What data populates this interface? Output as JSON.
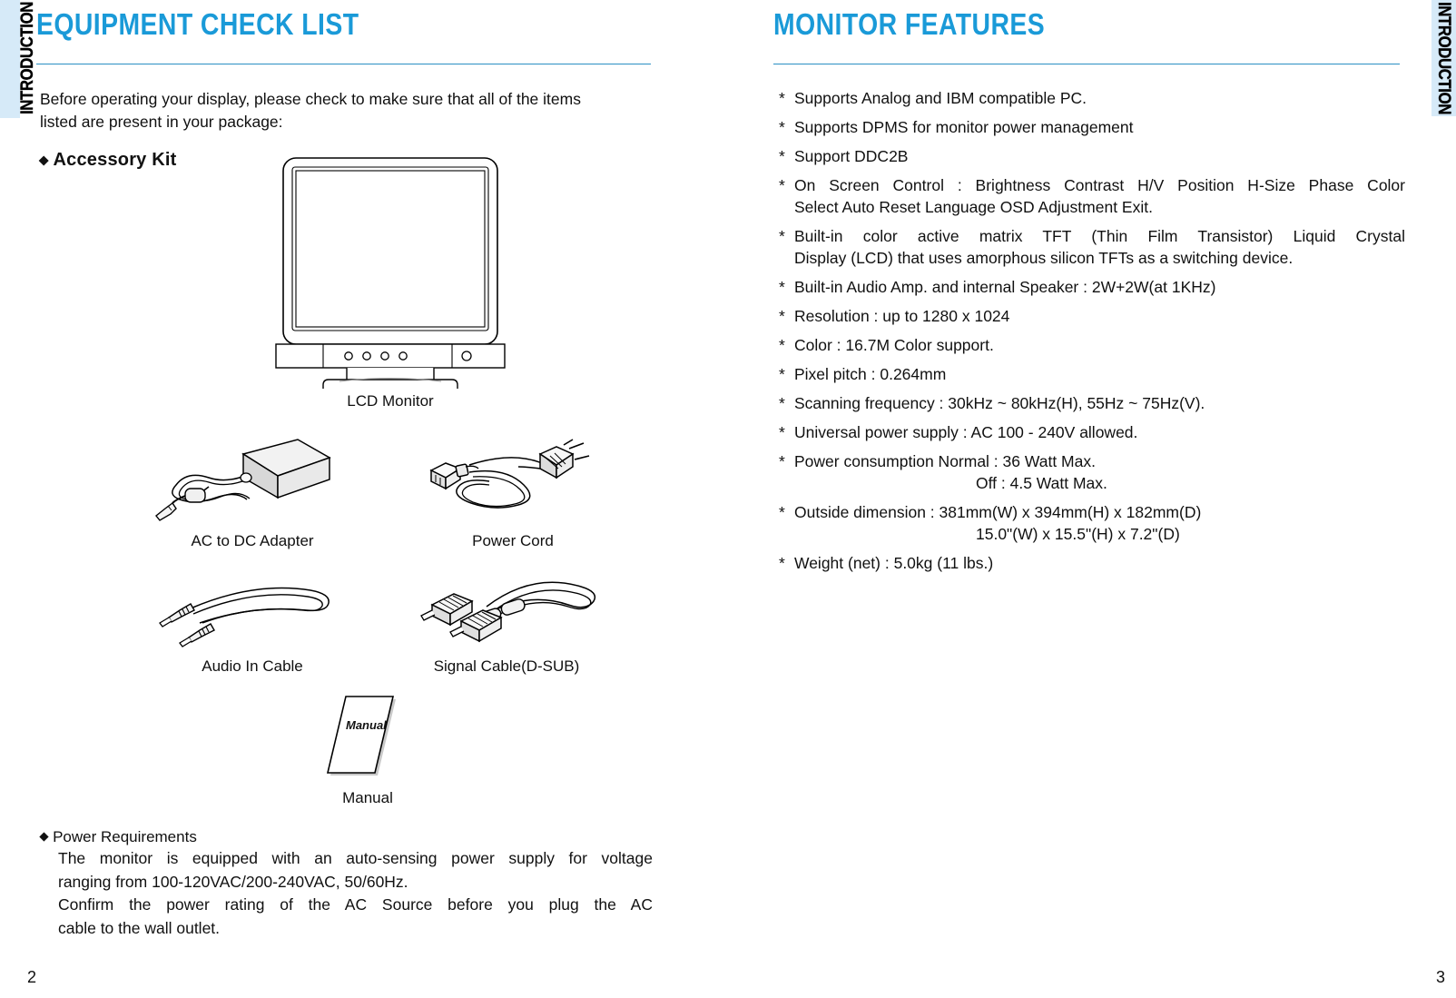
{
  "tabs": {
    "left_label": "INTRODUCTION",
    "right_label": "INTRODUCTION",
    "tab_color": "#d6eaf8"
  },
  "theme": {
    "heading_blue": "#1a9ad8",
    "rule_blue": "#2a8fc4",
    "text_black": "#101010"
  },
  "left_page": {
    "heading": "EQUIPMENT CHECK LIST",
    "intro_paragraph": "Before operating your display, please check to make sure that all of the items listed are present in your package:",
    "accessory_kit_title": "Accessory Kit",
    "bullet_glyph": "◆",
    "products": [
      {
        "name": "lcd-monitor",
        "caption": "LCD Monitor"
      },
      {
        "name": "ac-to-dc-adapter",
        "caption": "AC to DC Adapter"
      },
      {
        "name": "power-cord",
        "caption": "Power Cord"
      },
      {
        "name": "audio-in-cable",
        "caption": "Audio In Cable"
      },
      {
        "name": "signal-cable",
        "caption": "Signal Cable(D-SUB)"
      },
      {
        "name": "manual",
        "caption": "Manual",
        "art_label": "Manual"
      }
    ],
    "power_requirements": {
      "title": "Power Requirements",
      "line1": "The monitor is equipped with an auto-sensing power supply for voltage",
      "line2": "ranging from 100-120VAC/200-240VAC, 50/60Hz.",
      "line3": "Confirm the power rating of the AC Source before you plug the AC",
      "line4": "cable to the wall outlet."
    },
    "page_number": "2"
  },
  "right_page": {
    "heading": "MONITOR FEATURES",
    "star_glyph": "*",
    "features": [
      {
        "line1": "Supports Analog and IBM compatible PC."
      },
      {
        "line1": "Supports DPMS for monitor power management"
      },
      {
        "line1": "Support DDC2B"
      },
      {
        "line1": "On Screen Control : Brightness Contrast H/V Position H-Size Phase Color",
        "line2": "Select Auto Reset Language OSD Adjustment Exit.",
        "justify": true
      },
      {
        "line1": "Built-in color active matrix TFT (Thin Film Transistor) Liquid Crystal",
        "line2": "Display (LCD) that uses amorphous silicon TFTs as a switching device.",
        "justify": true
      },
      {
        "line1": "Built-in Audio Amp. and internal Speaker : 2W+2W(at 1KHz)"
      },
      {
        "line1": "Resolution : up to 1280 x 1024"
      },
      {
        "line1": "Color : 16.7M Color support."
      },
      {
        "line1": "Pixel pitch : 0.264mm"
      },
      {
        "line1": "Scanning frequency : 30kHz ~ 80kHz(H), 55Hz ~ 75Hz(V)."
      },
      {
        "line1": "Universal power supply : AC 100 - 240V allowed."
      },
      {
        "line1": "Power consumption Normal : 36 Watt Max.",
        "line2_center": "Off : 4.5 Watt Max."
      },
      {
        "line1": "Outside dimension : 381mm(W) x 394mm(H) x 182mm(D)",
        "line2_center": "15.0\"(W) x 15.5\"(H) x 7.2\"(D)"
      },
      {
        "line1": "Weight (net) : 5.0kg (11 lbs.)"
      }
    ],
    "page_number": "3"
  }
}
